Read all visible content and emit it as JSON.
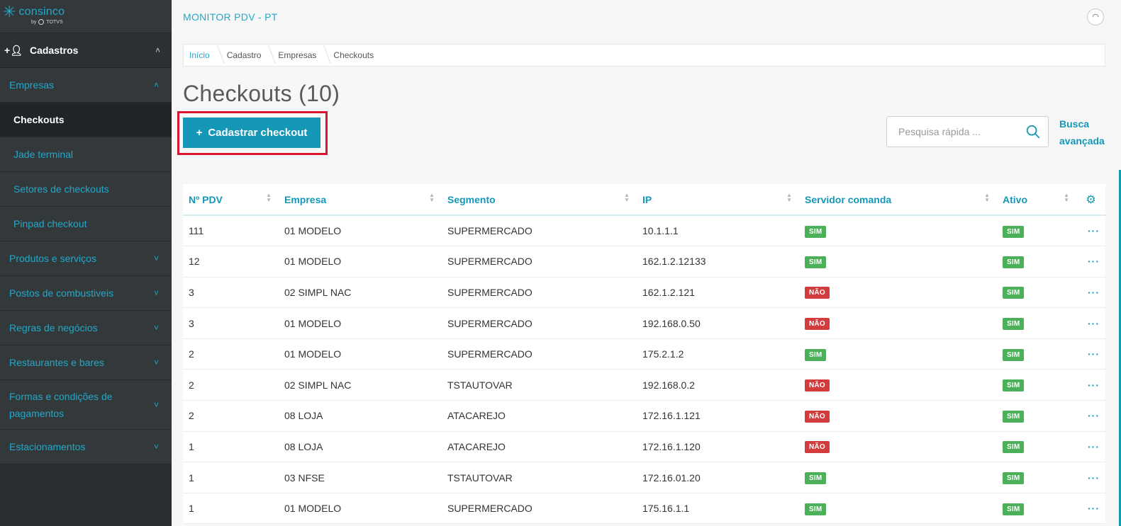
{
  "logo": {
    "brand": "consinco",
    "sub_by": "by",
    "sub_brand": "TOTVS"
  },
  "sidebar": {
    "section": {
      "label": "Cadastros",
      "icon": "add-user-icon"
    },
    "group_open": {
      "label": "Empresas"
    },
    "items": [
      {
        "label": "Checkouts",
        "active": true
      },
      {
        "label": "Jade terminal"
      },
      {
        "label": "Setores de checkouts"
      },
      {
        "label": "Pinpad checkout"
      }
    ],
    "groups": [
      {
        "label": "Produtos e serviços"
      },
      {
        "label": "Postos de combustiveis"
      },
      {
        "label": "Regras de negócios"
      },
      {
        "label": "Restaurantes e bares"
      },
      {
        "label": "Formas e condições de pagamentos"
      },
      {
        "label": "Estacionamentos"
      }
    ]
  },
  "header": {
    "title": "MONITOR PDV - PT",
    "user_icon": "user-icon"
  },
  "breadcrumb": [
    "Início",
    "Cadastro",
    "Empresas",
    "Checkouts"
  ],
  "page": {
    "title": "Checkouts (10)",
    "add_button": "Cadastrar checkout",
    "add_button_icon": "+",
    "search_placeholder": "Pesquisa rápida ...",
    "advanced_search": "Busca avançada"
  },
  "table": {
    "columns": [
      "Nº PDV",
      "Empresa",
      "Segmento",
      "IP",
      "Servidor comanda",
      "Ativo"
    ],
    "rows": [
      {
        "pdv": "111",
        "empresa": "01 MODELO",
        "segmento": "SUPERMERCADO",
        "ip": "10.1.1.1",
        "servidor": "SIM",
        "ativo": "SIM"
      },
      {
        "pdv": "12",
        "empresa": "01 MODELO",
        "segmento": "SUPERMERCADO",
        "ip": "162.1.2.12133",
        "servidor": "SIM",
        "ativo": "SIM"
      },
      {
        "pdv": "3",
        "empresa": "02 SIMPL NAC",
        "segmento": "SUPERMERCADO",
        "ip": "162.1.2.121",
        "servidor": "NÃO",
        "ativo": "SIM"
      },
      {
        "pdv": "3",
        "empresa": "01 MODELO",
        "segmento": "SUPERMERCADO",
        "ip": "192.168.0.50",
        "servidor": "NÃO",
        "ativo": "SIM"
      },
      {
        "pdv": "2",
        "empresa": "01 MODELO",
        "segmento": "SUPERMERCADO",
        "ip": "175.2.1.2",
        "servidor": "SIM",
        "ativo": "SIM"
      },
      {
        "pdv": "2",
        "empresa": "02 SIMPL NAC",
        "segmento": "TSTAUTOVAR",
        "ip": "192.168.0.2",
        "servidor": "NÃO",
        "ativo": "SIM"
      },
      {
        "pdv": "2",
        "empresa": "08 LOJA",
        "segmento": "ATACAREJO",
        "ip": "172.16.1.121",
        "servidor": "NÃO",
        "ativo": "SIM"
      },
      {
        "pdv": "1",
        "empresa": "08 LOJA",
        "segmento": "ATACAREJO",
        "ip": "172.16.1.120",
        "servidor": "NÃO",
        "ativo": "SIM"
      },
      {
        "pdv": "1",
        "empresa": "03 NFSE",
        "segmento": "TSTAUTOVAR",
        "ip": "172.16.01.20",
        "servidor": "SIM",
        "ativo": "SIM"
      },
      {
        "pdv": "1",
        "empresa": "01 MODELO",
        "segmento": "SUPERMERCADO",
        "ip": "175.16.1.1",
        "servidor": "SIM",
        "ativo": "SIM"
      }
    ],
    "row_action_icon": "more-dots-icon",
    "settings_icon": "gear-icon"
  },
  "colors": {
    "accent": "#1597b8",
    "sidebar": "#33393b",
    "success": "#4caf5a",
    "danger": "#d23c3c",
    "highlight": "#d7172f"
  }
}
